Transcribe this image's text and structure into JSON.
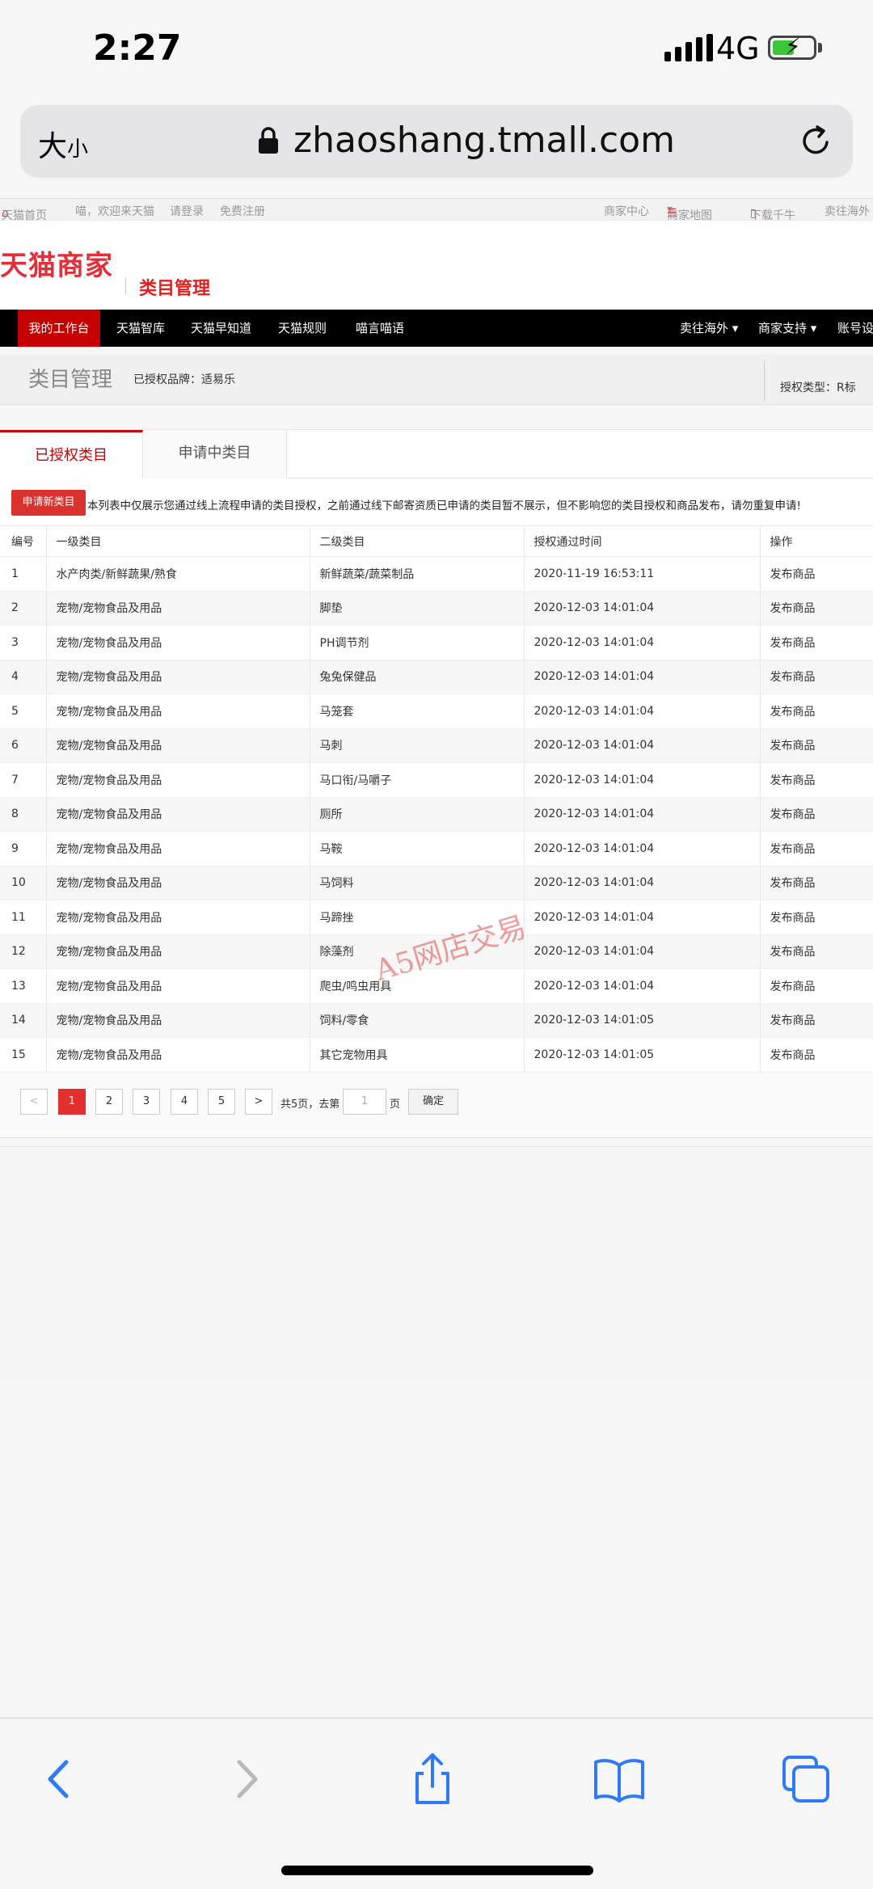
{
  "status_bar": {
    "time": "2:27",
    "network": "4G"
  },
  "browser": {
    "text_size_big": "大",
    "text_size_small": "小",
    "url": "zhaoshang.tmall.com"
  },
  "top_links": {
    "home": "天猫首页",
    "welcome": "喵，欢迎来天猫",
    "login": "请登录",
    "register": "免费注册",
    "merchant_center": "商家中心",
    "merchant_map": "商家地图",
    "download": "下载千牛",
    "overseas": "卖往海外"
  },
  "header": {
    "logo": "天猫商家",
    "title": "类目管理"
  },
  "nav": {
    "items": [
      "我的工作台",
      "天猫智库",
      "天猫早知道",
      "天猫规则",
      "喵言喵语"
    ],
    "right_items": [
      "卖往海外 ▾",
      "商家支持 ▾",
      "账号设"
    ]
  },
  "sub_header": {
    "title": "类目管理",
    "brand": "已授权品牌：适易乐",
    "auth_type": "授权类型：R标"
  },
  "tabs": {
    "active": "已授权类目",
    "inactive": "申请中类目"
  },
  "notice": {
    "apply_button": "申请新类目",
    "text": "本列表中仅展示您通过线上流程申请的类目授权，之前通过线下邮寄资质已申请的类目暂不展示，但不影响您的类目授权和商品发布，请勿重复申请!"
  },
  "table": {
    "headers": {
      "num": "编号",
      "level1": "一级类目",
      "level2": "二级类目",
      "time": "授权通过时间",
      "op": "操作"
    },
    "rows": [
      {
        "num": "1",
        "level1": "水产肉类/新鲜蔬果/熟食",
        "level2": "新鲜蔬菜/蔬菜制品",
        "time": "2020-11-19 16:53:11",
        "op": "发布商品"
      },
      {
        "num": "2",
        "level1": "宠物/宠物食品及用品",
        "level2": "脚垫",
        "time": "2020-12-03 14:01:04",
        "op": "发布商品"
      },
      {
        "num": "3",
        "level1": "宠物/宠物食品及用品",
        "level2": "PH调节剂",
        "time": "2020-12-03 14:01:04",
        "op": "发布商品"
      },
      {
        "num": "4",
        "level1": "宠物/宠物食品及用品",
        "level2": "兔兔保健品",
        "time": "2020-12-03 14:01:04",
        "op": "发布商品"
      },
      {
        "num": "5",
        "level1": "宠物/宠物食品及用品",
        "level2": "马笼套",
        "time": "2020-12-03 14:01:04",
        "op": "发布商品"
      },
      {
        "num": "6",
        "level1": "宠物/宠物食品及用品",
        "level2": "马刺",
        "time": "2020-12-03 14:01:04",
        "op": "发布商品"
      },
      {
        "num": "7",
        "level1": "宠物/宠物食品及用品",
        "level2": "马口衔/马嚼子",
        "time": "2020-12-03 14:01:04",
        "op": "发布商品"
      },
      {
        "num": "8",
        "level1": "宠物/宠物食品及用品",
        "level2": "厕所",
        "time": "2020-12-03 14:01:04",
        "op": "发布商品"
      },
      {
        "num": "9",
        "level1": "宠物/宠物食品及用品",
        "level2": "马鞍",
        "time": "2020-12-03 14:01:04",
        "op": "发布商品"
      },
      {
        "num": "10",
        "level1": "宠物/宠物食品及用品",
        "level2": "马饲料",
        "time": "2020-12-03 14:01:04",
        "op": "发布商品"
      },
      {
        "num": "11",
        "level1": "宠物/宠物食品及用品",
        "level2": "马蹄挫",
        "time": "2020-12-03 14:01:04",
        "op": "发布商品"
      },
      {
        "num": "12",
        "level1": "宠物/宠物食品及用品",
        "level2": "除藻剂",
        "time": "2020-12-03 14:01:04",
        "op": "发布商品"
      },
      {
        "num": "13",
        "level1": "宠物/宠物食品及用品",
        "level2": "爬虫/鸣虫用具",
        "time": "2020-12-03 14:01:04",
        "op": "发布商品"
      },
      {
        "num": "14",
        "level1": "宠物/宠物食品及用品",
        "level2": "饲料/零食",
        "time": "2020-12-03 14:01:05",
        "op": "发布商品"
      },
      {
        "num": "15",
        "level1": "宠物/宠物食品及用品",
        "level2": "其它宠物用具",
        "time": "2020-12-03 14:01:05",
        "op": "发布商品"
      }
    ]
  },
  "pagination": {
    "prev": "<",
    "pages": [
      "1",
      "2",
      "3",
      "4",
      "5"
    ],
    "next": ">",
    "total_text": "共5页，去第",
    "input_value": "1",
    "page_suffix": "页",
    "confirm": "确定"
  },
  "watermark": "A5网店交易",
  "colors": {
    "brand_red": "#c40000",
    "link_blue": "#3a7dc8",
    "battery_green": "#3ec63a"
  }
}
